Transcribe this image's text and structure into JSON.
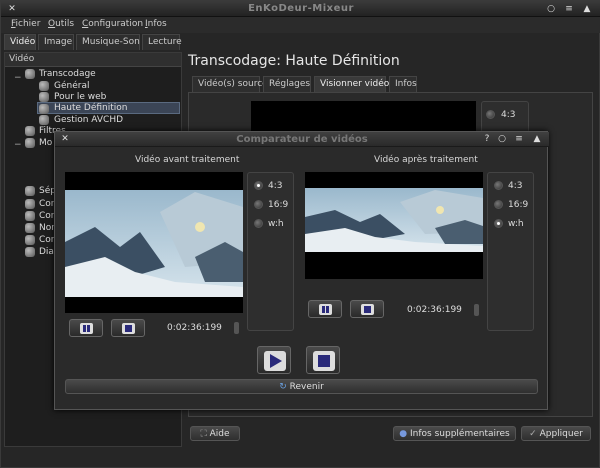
{
  "app": {
    "title": "EnKoDeur-Mixeur"
  },
  "menu": [
    "Fichier",
    "Outils",
    "Configuration",
    "Infos"
  ],
  "main_tabs": [
    "Vidéo",
    "Image",
    "Musique-Son",
    "Lecture"
  ],
  "left_panel": {
    "header": "Vidéo",
    "tree": [
      {
        "label": "Transcodage"
      },
      {
        "label": "Général"
      },
      {
        "label": "Pour le web"
      },
      {
        "label": "Haute Définition"
      },
      {
        "label": "Gestion AVCHD"
      },
      {
        "label": "Filtres"
      },
      {
        "label": "Mo"
      },
      {
        "label": "Sép"
      },
      {
        "label": "Con"
      },
      {
        "label": "Con"
      },
      {
        "label": "Nor"
      },
      {
        "label": "Con"
      },
      {
        "label": "Dia"
      }
    ]
  },
  "section_title": "Transcodage: Haute Définition",
  "sub_tabs": [
    "Vidéo(s) source",
    "Réglages",
    "Visionner vidéo",
    "Infos"
  ],
  "bg_radio_label": "4:3",
  "footer": {
    "help": "Aide",
    "more_info": "Infos supplémentaires",
    "apply": "Appliquer"
  },
  "dialog": {
    "title": "Comparateur de vidéos",
    "title_buttons": [
      "?",
      "○",
      "≡",
      "▲"
    ],
    "before_label": "Vidéo avant traitement",
    "after_label": "Vidéo après traitement",
    "before_time": "0:02:36:199",
    "after_time": "0:02:36:199",
    "ratios": [
      "4:3",
      "16:9",
      "w:h"
    ],
    "before_selected": "4:3",
    "after_selected": "w:h",
    "back_label": "Revenir"
  },
  "window_buttons": [
    "○",
    "≡",
    "▲"
  ],
  "colors": {
    "accent": "#2a2a7a",
    "selection": "#3b4556"
  }
}
